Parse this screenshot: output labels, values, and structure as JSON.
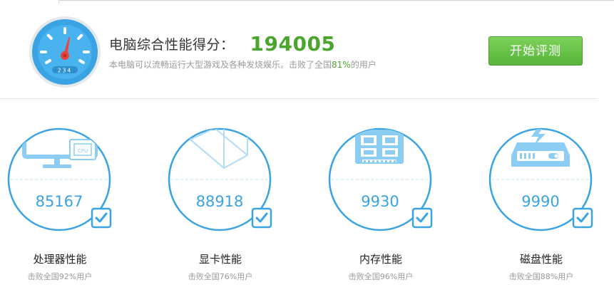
{
  "header": {
    "title": "电脑综合性能得分：",
    "score": "194005",
    "subtitle_prefix": "本电脑可以流畅运行大型游戏及各种发烧娱乐。击败了全国",
    "subtitle_percent": "81%",
    "subtitle_suffix": "的用户",
    "start_button": "开始评测",
    "gauge_readout": "234"
  },
  "categories": [
    {
      "name": "处理器性能",
      "score": "85167",
      "sub": "击败全国92%用户",
      "icon": "cpu-monitor-icon",
      "chip_label": "CPU"
    },
    {
      "name": "显卡性能",
      "score": "88918",
      "sub": "击败全国76%用户",
      "icon": "graphics-cube-icon"
    },
    {
      "name": "内存性能",
      "score": "9930",
      "sub": "击败全国96%用户",
      "icon": "memory-module-icon"
    },
    {
      "name": "磁盘性能",
      "score": "9990",
      "sub": "击败全国88%用户",
      "icon": "disk-drive-icon"
    }
  ],
  "colors": {
    "accent_blue": "#3aa3e3",
    "score_green": "#4aa52c",
    "needle_red": "#e8463b",
    "button_green": "#5cb83e"
  }
}
